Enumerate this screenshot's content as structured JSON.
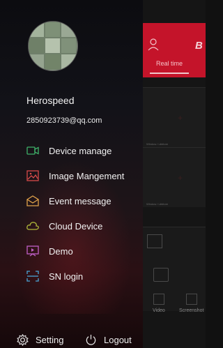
{
  "drawer": {
    "username": "Herospeed",
    "email": "2850923739@qq.com",
    "menu": [
      {
        "label": "Device manage",
        "icon": "camera-icon",
        "color": "#3fb26a"
      },
      {
        "label": "Image Mangement",
        "icon": "image-icon",
        "color": "#d84a4a"
      },
      {
        "label": "Event message",
        "icon": "envelope-icon",
        "color": "#e0a24a"
      },
      {
        "label": "Cloud Device",
        "icon": "cloud-icon",
        "color": "#b0b83a"
      },
      {
        "label": "Demo",
        "icon": "demo-screen-icon",
        "color": "#c060c8"
      },
      {
        "label": "SN login",
        "icon": "scan-icon",
        "color": "#4aa6d8"
      }
    ],
    "footer": {
      "setting_label": "Setting",
      "logout_label": "Logout"
    }
  },
  "background_app": {
    "brand": "B",
    "tab_realtime": "Real time",
    "panel_label": "Window / ubbtore",
    "tool_video": "Video",
    "tool_screenshot": "Screenshot",
    "accent": "#c4142a"
  }
}
